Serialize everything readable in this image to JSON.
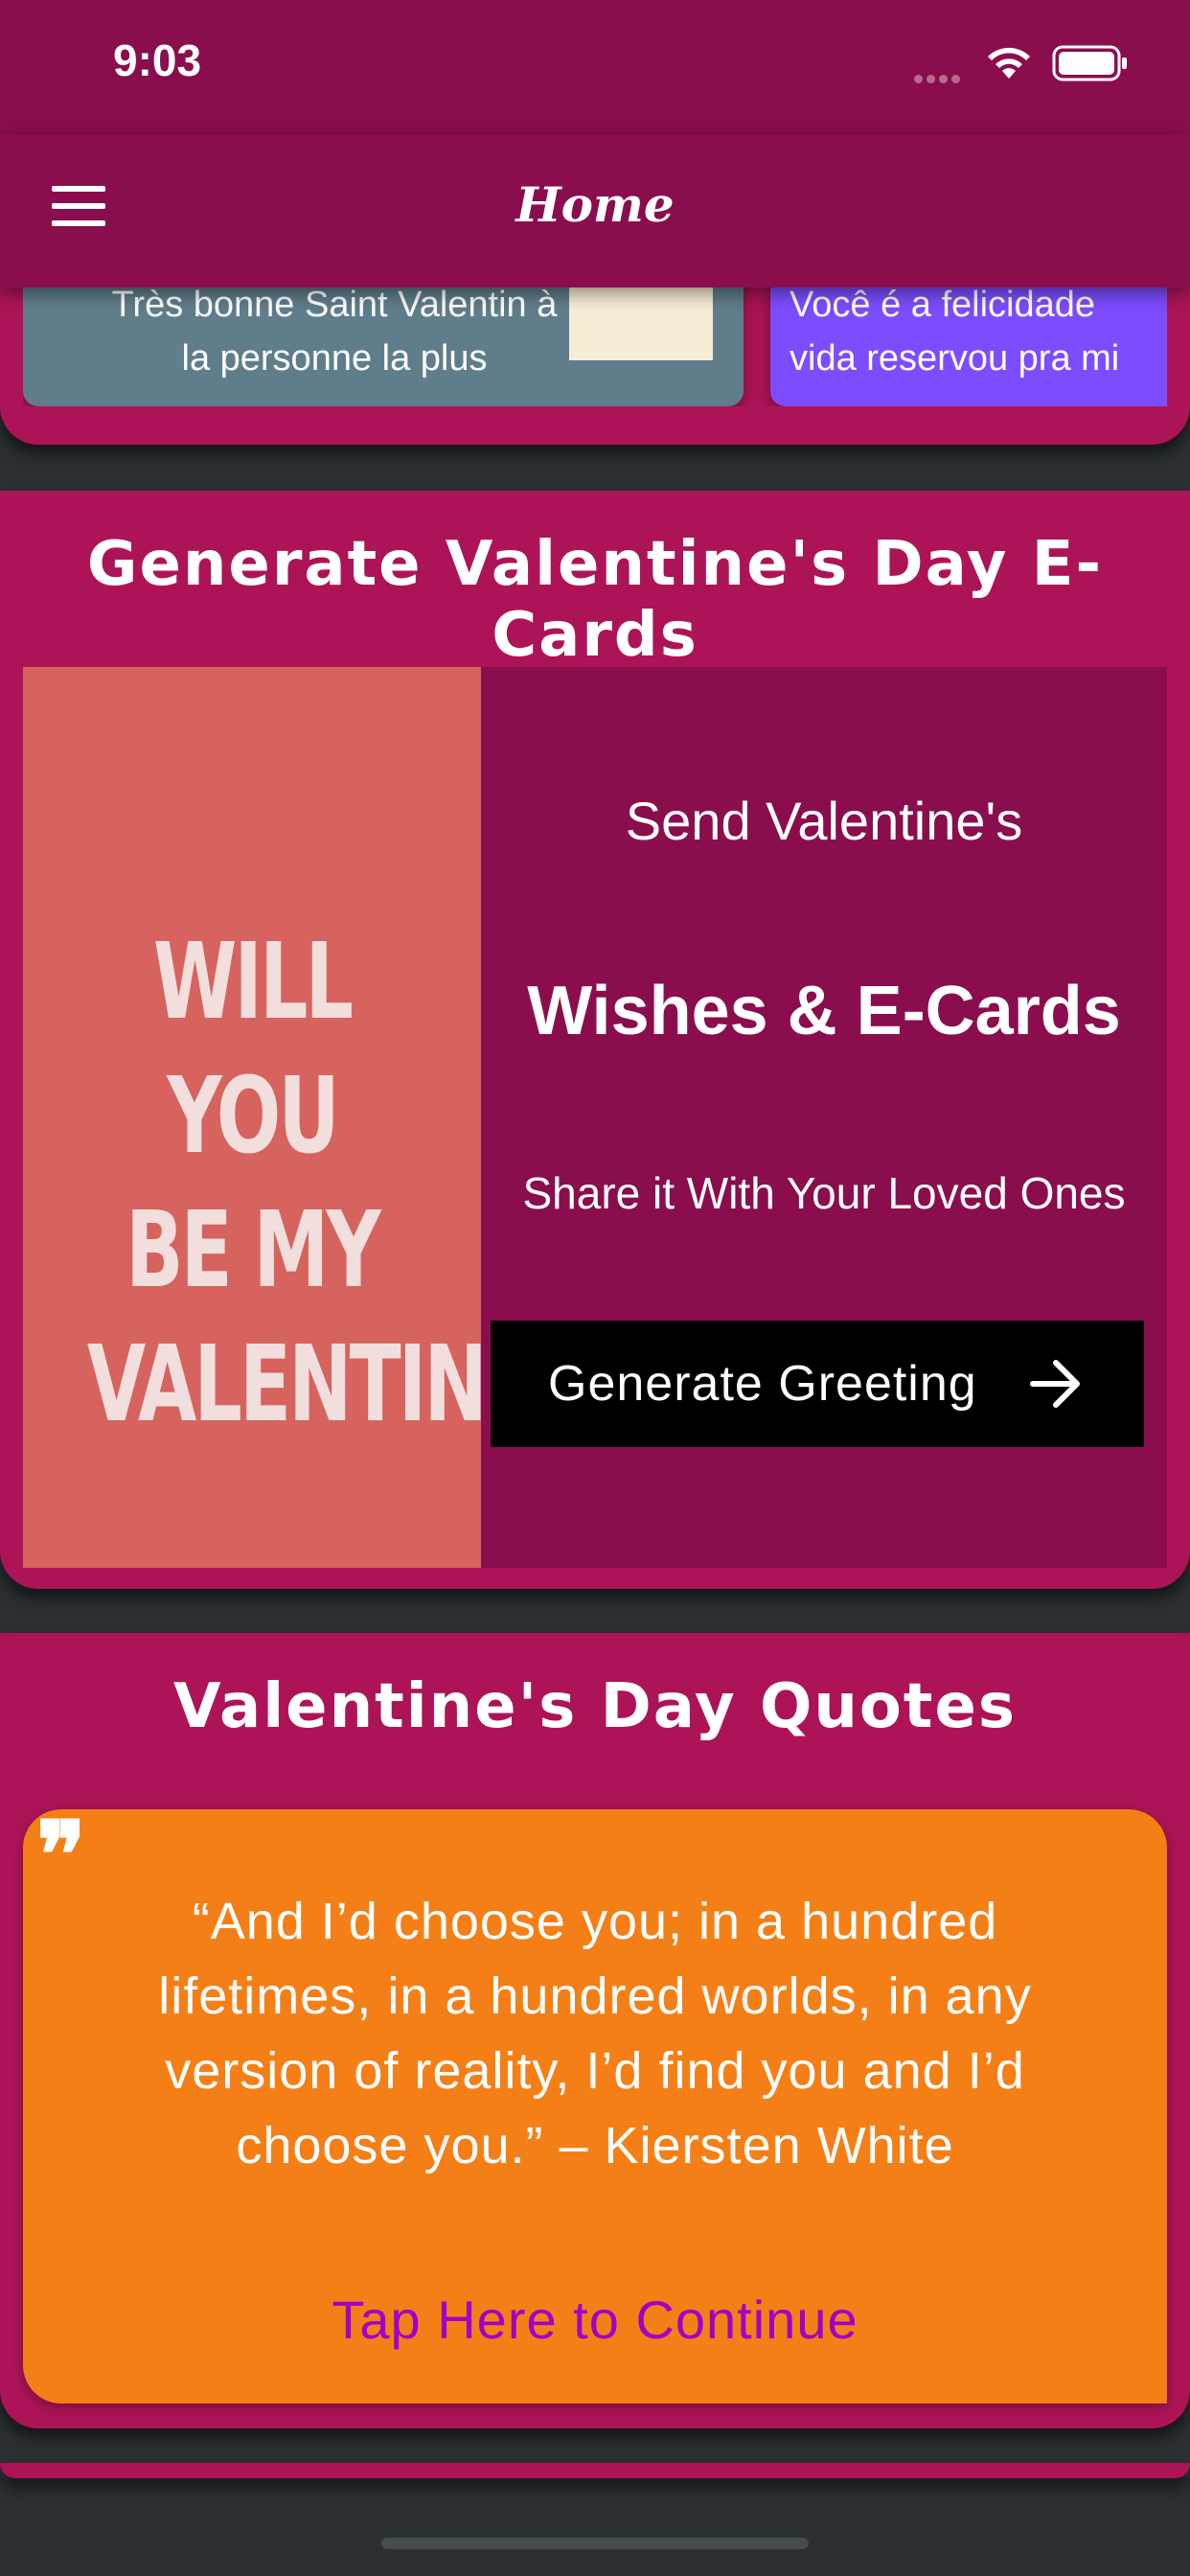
{
  "status_bar": {
    "time": "9:03"
  },
  "header": {
    "title": "Home"
  },
  "top_cards": [
    {
      "lines": [
        "Très bonne Saint Valentin à",
        "la personne la plus"
      ]
    },
    {
      "lines": [
        "Você é a felicidade",
        "vida reservou pra mi"
      ]
    }
  ],
  "ecards": {
    "title": "Generate Valentine's Day E-Cards",
    "image_text": [
      "WILL YOU",
      "BE MY",
      "VALENTINE?"
    ],
    "line1": "Send Valentine's",
    "line2": "Wishes & E-Cards",
    "line3": "Share it With Your Loved Ones",
    "button_label": "Generate Greeting"
  },
  "quotes": {
    "title": "Valentine's Day Quotes",
    "quote_mark": "❞",
    "text": "“And I’d choose you; in a hundred lifetimes, in a hundred worlds, in any version of reality, I’d find you and I’d choose you.” – Kiersten White",
    "continue_label": "Tap Here to Continue"
  },
  "colors": {
    "header": "#8a0e4e",
    "section": "#ad1457",
    "quote_card": "#f57f17",
    "link": "#a000c8",
    "card_grey": "#607d8b",
    "card_purple": "#7c4dff"
  },
  "icons": [
    "menu-icon",
    "wifi-icon",
    "battery-icon",
    "arrow-right-icon",
    "quote-icon"
  ]
}
